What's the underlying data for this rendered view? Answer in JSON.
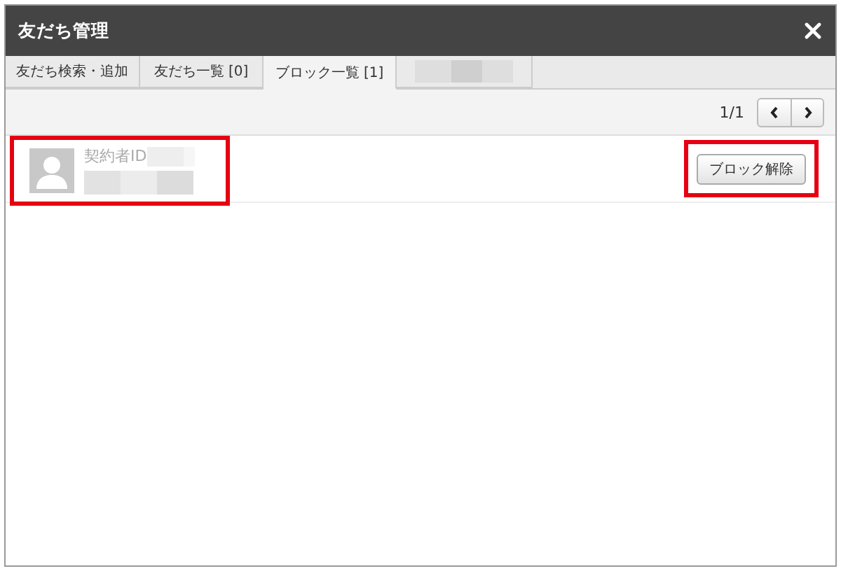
{
  "window": {
    "title": "友だち管理"
  },
  "tabs": [
    {
      "label": "友だち検索・追加",
      "selected": false,
      "kind": "text"
    },
    {
      "label": "友だち一覧 [0]",
      "selected": false,
      "kind": "text"
    },
    {
      "label": "ブロック一覧 [1]",
      "selected": true,
      "kind": "text"
    },
    {
      "selected": false,
      "kind": "redacted"
    }
  ],
  "pager": {
    "page": "1/1"
  },
  "rows": [
    {
      "label": "契約者ID",
      "highlighted": true,
      "action": {
        "label": "ブロック解除",
        "highlighted": true
      }
    }
  ]
}
